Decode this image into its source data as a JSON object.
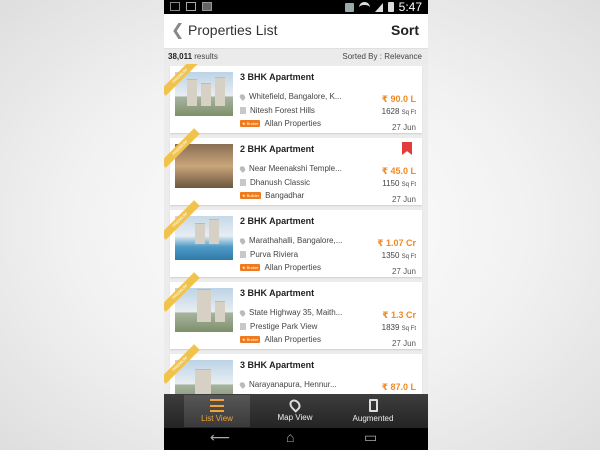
{
  "status": {
    "time": "5:47"
  },
  "header": {
    "back": "❮",
    "title": "Properties List",
    "sort": "Sort"
  },
  "subbar": {
    "count": "38,011",
    "count_suffix": " results",
    "sorted": "Sorted By : Relevance"
  },
  "listings": [
    {
      "type": "3 BHK Apartment",
      "location": "Whitefield, Bangalore, K...",
      "project": "Nitesh Forest Hills",
      "agent": "Allan Properties",
      "price": "₹ 90.0 L",
      "area": "1628",
      "area_unit": "Sq Ft",
      "date": "27 Jun",
      "ribbon": "PREMIUM",
      "badge": "★ Broker",
      "bookmarked": false
    },
    {
      "type": "2 BHK Apartment",
      "location": "Near Meenakshi Temple...",
      "project": "Dhanush Classic",
      "agent": "Bangadhar",
      "price": "₹ 45.0 L",
      "area": "1150",
      "area_unit": "Sq Ft",
      "date": "27 Jun",
      "ribbon": "PREMIUM",
      "badge": "★ Builder",
      "bookmarked": true
    },
    {
      "type": "2 BHK Apartment",
      "location": "Marathahalli, Bangalore,...",
      "project": "Purva Riviera",
      "agent": "Allan Properties",
      "price": "₹ 1.07 Cr",
      "area": "1350",
      "area_unit": "Sq Ft",
      "date": "27 Jun",
      "ribbon": "PREMIUM",
      "badge": "★ Broker",
      "bookmarked": false
    },
    {
      "type": "3 BHK Apartment",
      "location": "State Highway 35, Maith...",
      "project": "Prestige Park View",
      "agent": "Allan Properties",
      "price": "₹ 1.3 Cr",
      "area": "1839",
      "area_unit": "Sq Ft",
      "date": "27 Jun",
      "ribbon": "PREMIUM",
      "badge": "★ Broker",
      "bookmarked": false
    },
    {
      "type": "3 BHK Apartment",
      "location": "Narayanapura, Hennur...",
      "project": "",
      "agent": "",
      "price": "₹ 87.0 L",
      "area": "",
      "area_unit": "",
      "date": "",
      "ribbon": "PREMIUM",
      "badge": "",
      "bookmarked": false
    }
  ],
  "tabs": [
    {
      "label": "List View",
      "icon": "list-icon",
      "active": true
    },
    {
      "label": "Map View",
      "icon": "map-pin-icon",
      "active": false
    },
    {
      "label": "Augmented",
      "icon": "phone-icon",
      "active": false
    }
  ],
  "nav": {
    "back": "⟵",
    "home": "⌂",
    "recent": "▭"
  },
  "colors": {
    "accent": "#f08a24",
    "ribbon": "#f0c24e",
    "bookmark": "#e23b3b",
    "tab_active": "#f0a43a"
  }
}
